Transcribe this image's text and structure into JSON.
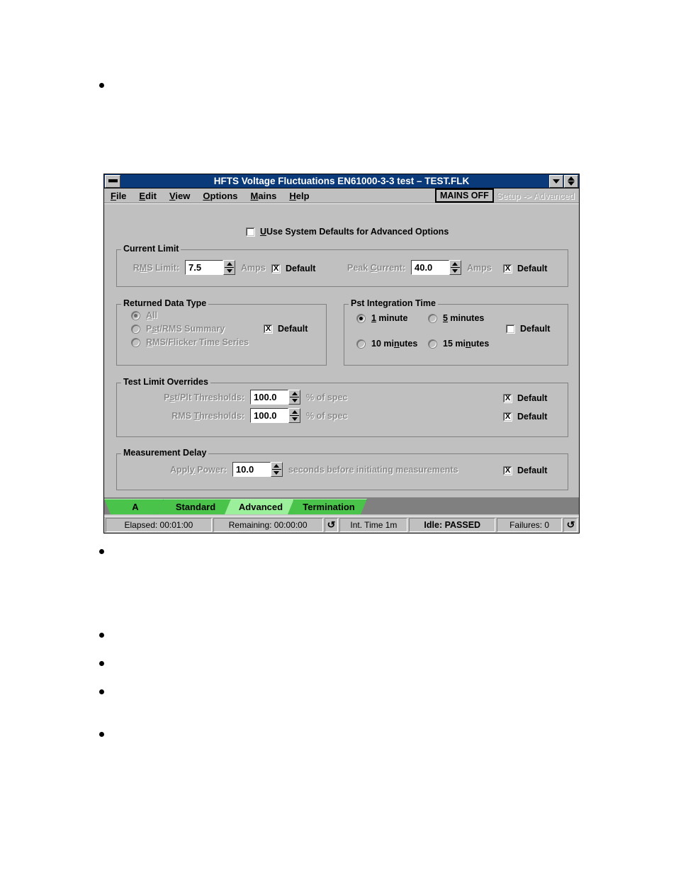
{
  "window": {
    "title": "HFTS Voltage Fluctuations EN61000-3-3 test – TEST.FLK",
    "sysmenu_icon": "window-menu-icon",
    "minimize_icon": "minimize-icon",
    "restore_icon": "restore-icon"
  },
  "menubar": {
    "items": [
      {
        "label": "File",
        "accel": "F"
      },
      {
        "label": "Edit",
        "accel": "E"
      },
      {
        "label": "View",
        "accel": "V"
      },
      {
        "label": "Options",
        "accel": "O"
      },
      {
        "label": "Mains",
        "accel": "M"
      },
      {
        "label": "Help",
        "accel": "H"
      }
    ],
    "mains_status": "MAINS OFF",
    "breadcrumb": "Setup -> Advanced"
  },
  "main": {
    "use_system_defaults": {
      "label": "Use System Defaults for Advanced Options",
      "checked": false
    },
    "current_limit": {
      "title": "Current Limit",
      "rms_label": "RMS Limit:",
      "rms_value": "7.5",
      "rms_units": "Amps",
      "rms_default_label": "Default",
      "rms_default_checked": true,
      "peak_label": "Peak Current:",
      "peak_value": "40.0",
      "peak_units": "Amps",
      "peak_default_label": "Default",
      "peak_default_checked": true
    },
    "returned_data_type": {
      "title": "Returned Data Type",
      "options": [
        {
          "label": "All",
          "selected": true
        },
        {
          "label": "Pst/RMS Summary",
          "selected": false
        },
        {
          "label": "RMS/Flicker Time Series",
          "selected": false
        }
      ],
      "default_label": "Default",
      "default_checked": true
    },
    "pst_integration_time": {
      "title": "Pst Integration Time",
      "options": [
        {
          "label": "1 minute",
          "selected": true
        },
        {
          "label": "5 minutes",
          "selected": false
        },
        {
          "label": "10 minutes",
          "selected": false
        },
        {
          "label": "15 minutes",
          "selected": false
        }
      ],
      "default_label": "Default",
      "default_checked": false
    },
    "test_limit_overrides": {
      "title": "Test Limit Overrides",
      "rows": [
        {
          "label": "Pst/Plt Thresholds:",
          "value": "100.0",
          "units": "% of spec",
          "default_label": "Default",
          "default_checked": true
        },
        {
          "label": "RMS Thresholds:",
          "value": "100.0",
          "units": "% of spec",
          "default_label": "Default",
          "default_checked": true
        }
      ]
    },
    "measurement_delay": {
      "title": "Measurement Delay",
      "label": "Apply Power:",
      "value": "10.0",
      "units": "seconds before initiating measurements",
      "default_label": "Default",
      "default_checked": true
    }
  },
  "tabs": [
    {
      "label": "A",
      "selected": false
    },
    {
      "label": "Standard",
      "selected": false
    },
    {
      "label": "Advanced",
      "selected": true
    },
    {
      "label": "Termination",
      "selected": false
    }
  ],
  "statusbar": {
    "elapsed": "Elapsed: 00:01:00",
    "remaining": "Remaining: 00:00:00",
    "refresh_icon_1": "refresh-icon",
    "int_time": "Int. Time 1m",
    "state": "Idle: PASSED",
    "failures": "Failures: 0",
    "refresh_icon_2": "refresh-icon"
  },
  "colors": {
    "titlebar": "#0a3a7a",
    "window_face": "#c0c0c0",
    "tab": "#49c349",
    "tab_selected": "#9cf09c",
    "tabstrip_bg": "#808080",
    "disabled_text": "#8a8a8a"
  }
}
